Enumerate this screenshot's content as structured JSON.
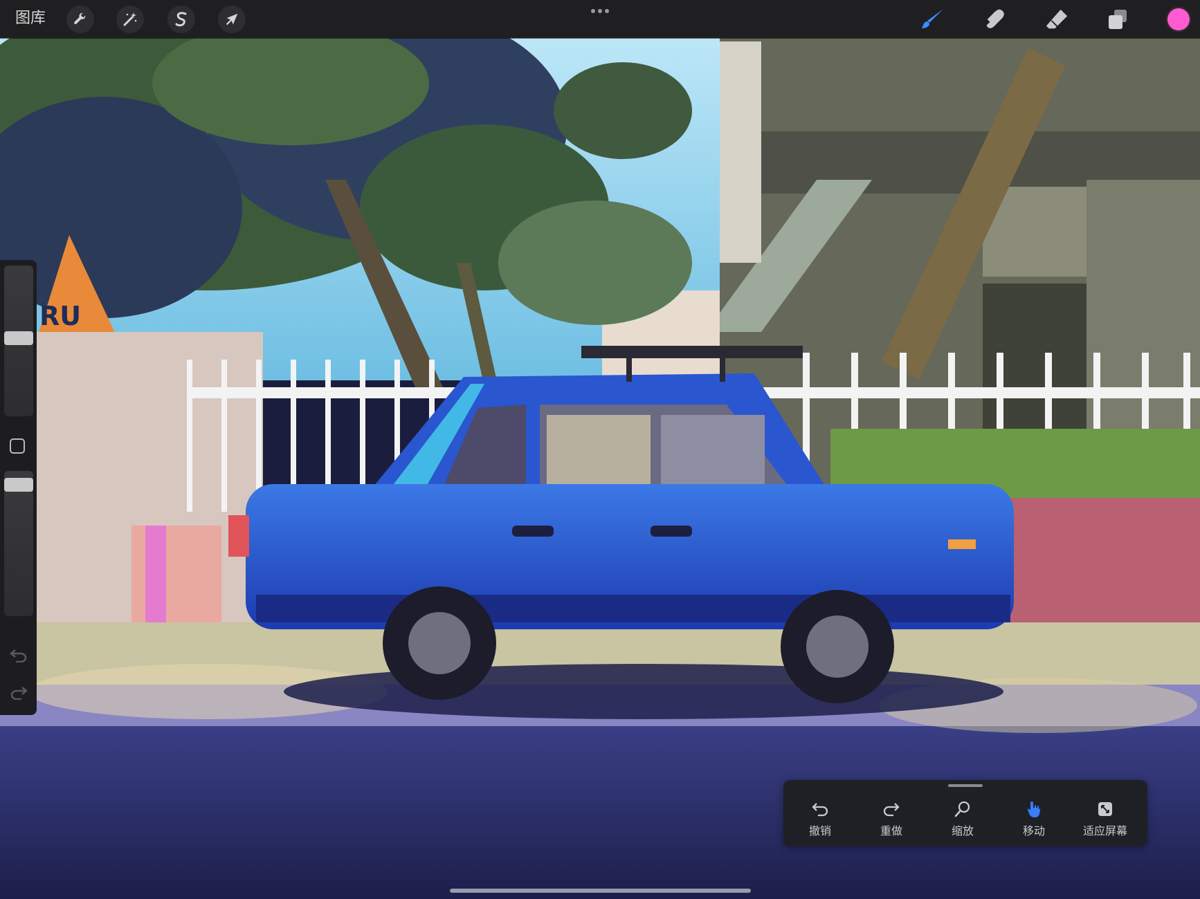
{
  "app": {
    "gallery_label": "图库"
  },
  "toolbar_left": [
    {
      "name": "actions",
      "icon": "wrench-icon"
    },
    {
      "name": "adjustments",
      "icon": "magic-wand-icon"
    },
    {
      "name": "selection",
      "icon": "selection-s-icon"
    },
    {
      "name": "transform",
      "icon": "arrow-cursor-icon"
    }
  ],
  "toolbar_right": [
    {
      "name": "brush",
      "icon": "brush-icon",
      "active": true,
      "color": "#3d8bff"
    },
    {
      "name": "smudge",
      "icon": "smudge-finger-icon"
    },
    {
      "name": "eraser",
      "icon": "eraser-icon"
    },
    {
      "name": "layers",
      "icon": "layers-icon"
    }
  ],
  "current_color": "#ff5bd3",
  "sidebar": {
    "brush_size_level": 0.52,
    "opacity_level": 0.05
  },
  "quick_menu": {
    "items": [
      {
        "key": "undo",
        "label": "撤销",
        "icon": "undo-arrow-icon"
      },
      {
        "key": "redo",
        "label": "重做",
        "icon": "redo-arrow-icon"
      },
      {
        "key": "zoom",
        "label": "缩放",
        "icon": "magnifier-icon"
      },
      {
        "key": "move",
        "label": "移动",
        "icon": "hand-pointer-icon",
        "active": true,
        "color": "#3a7dff"
      },
      {
        "key": "fit",
        "label": "适应屏幕",
        "icon": "fit-screen-icon"
      }
    ]
  },
  "artwork": {
    "sign_text": "RU",
    "palette": {
      "sky": "#8fd6f2",
      "car": "#2e5fd6",
      "fence": "#f3f3f3",
      "tree": "#3d5a3a",
      "road": "#2b2f6a"
    }
  }
}
